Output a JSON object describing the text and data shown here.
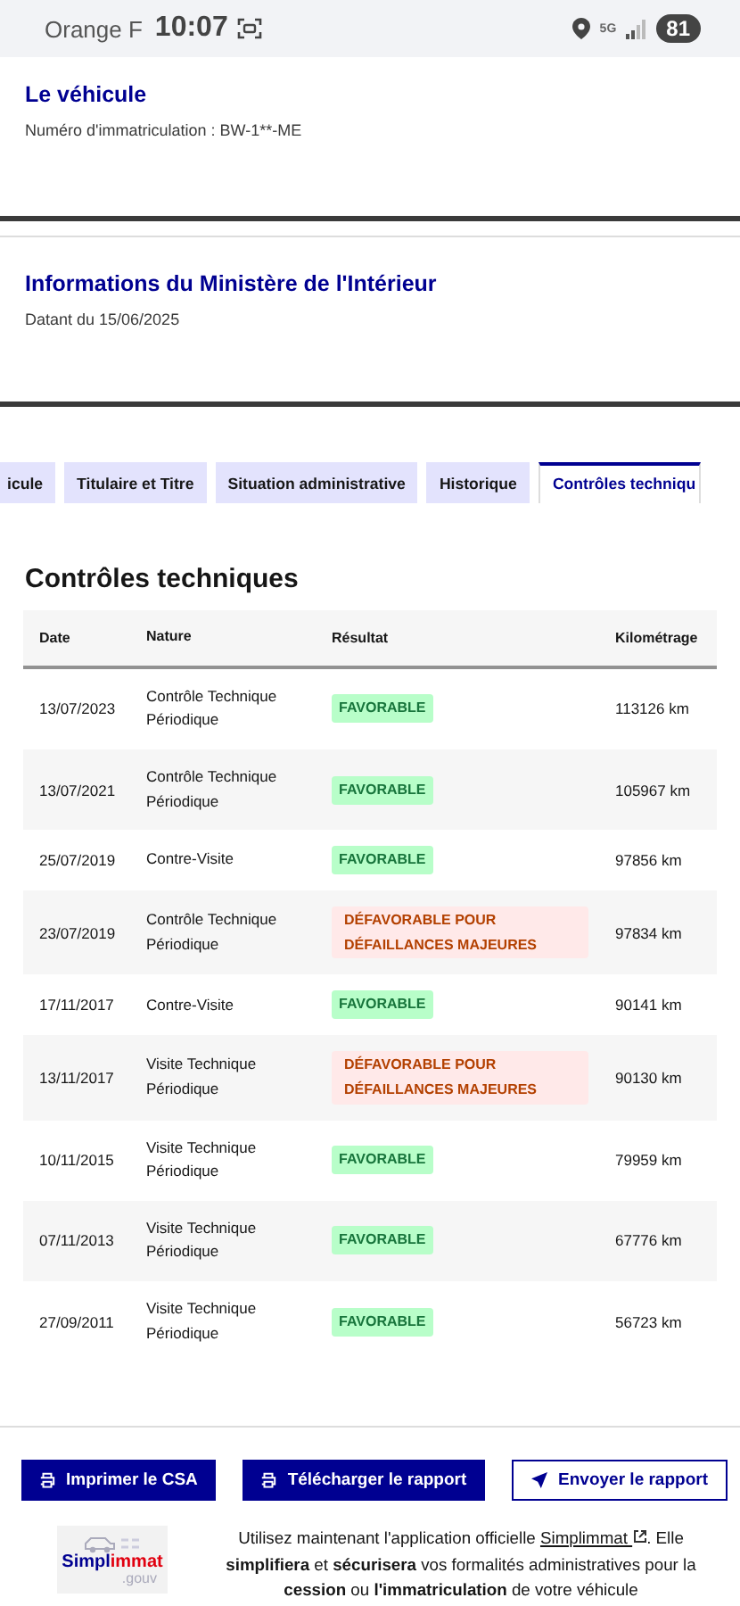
{
  "status_bar": {
    "carrier": "Orange F",
    "time": "10:07",
    "network": "5G",
    "battery": "81"
  },
  "vehicle": {
    "title": "Le véhicule",
    "plate": "Numéro d'immatriculation : BW-1**-ME"
  },
  "ministry": {
    "title": "Informations du Ministère de l'Intérieur",
    "date": "Datant du 15/06/2025"
  },
  "tabs": [
    {
      "label": "icule",
      "selected": false
    },
    {
      "label": "Titulaire et Titre",
      "selected": false
    },
    {
      "label": "Situation administrative",
      "selected": false
    },
    {
      "label": "Historique",
      "selected": false
    },
    {
      "label": "Contrôles techniqu",
      "selected": true
    }
  ],
  "section_title": "Contrôles techniques",
  "table": {
    "columns": [
      "Date",
      "Nature",
      "Résultat",
      "Kilométrage"
    ],
    "rows": [
      {
        "date": "13/07/2023",
        "nature": "Contrôle Technique Périodique",
        "result": "FAVORABLE",
        "kind": "favorable",
        "km": "113126 km"
      },
      {
        "date": "13/07/2021",
        "nature": "Contrôle Technique Périodique",
        "result": "FAVORABLE",
        "kind": "favorable",
        "km": "105967 km"
      },
      {
        "date": "25/07/2019",
        "nature": "Contre-Visite",
        "result": "FAVORABLE",
        "kind": "favorable",
        "km": "97856 km"
      },
      {
        "date": "23/07/2019",
        "nature": "Contrôle Technique Périodique",
        "result": "DÉFAVORABLE POUR DÉFAILLANCES MAJEURES",
        "kind": "defavorable",
        "km": "97834 km"
      },
      {
        "date": "17/11/2017",
        "nature": "Contre-Visite",
        "result": "FAVORABLE",
        "kind": "favorable",
        "km": "90141 km"
      },
      {
        "date": "13/11/2017",
        "nature": "Visite Technique Périodique",
        "result": "DÉFAVORABLE POUR DÉFAILLANCES MAJEURES",
        "kind": "defavorable",
        "km": "90130 km"
      },
      {
        "date": "10/11/2015",
        "nature": "Visite Technique Périodique",
        "result": "FAVORABLE",
        "kind": "favorable",
        "km": "79959 km"
      },
      {
        "date": "07/11/2013",
        "nature": "Visite Technique Périodique",
        "result": "FAVORABLE",
        "kind": "favorable",
        "km": "67776 km"
      },
      {
        "date": "27/09/2011",
        "nature": "Visite Technique Périodique",
        "result": "FAVORABLE",
        "kind": "favorable",
        "km": "56723 km"
      }
    ]
  },
  "buttons": [
    {
      "label": "Imprimer le CSA",
      "kind": "primary"
    },
    {
      "label": "Télécharger le rapport",
      "kind": "primary"
    },
    {
      "label": "Envoyer le rapport",
      "kind": "secondary"
    }
  ],
  "promo": {
    "logo": {
      "prefix": "Simpl",
      "accent": "immat",
      "suffix": ".gouv"
    },
    "intro": "Utilisez maintenant l'application officielle",
    "link": "Simplimmat",
    "after_link": ".",
    "body": "Elle **simplifiera** et **sécurisera** vos formalités administratives pour la **cession** ou **l'immatriculation** de votre véhicule"
  }
}
